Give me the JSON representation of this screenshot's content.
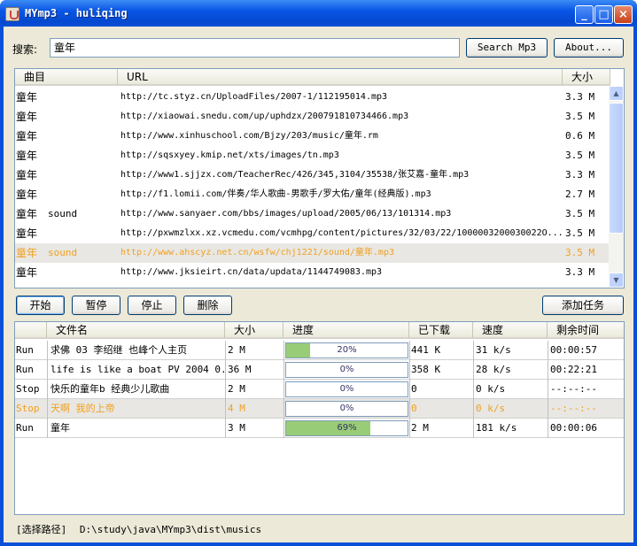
{
  "window": {
    "title": "MYmp3 - huliqing"
  },
  "search": {
    "label": "搜索:",
    "value": "童年",
    "search_button": "Search Mp3",
    "about_button": "About..."
  },
  "results": {
    "headers": {
      "song": "曲目",
      "url": "URL",
      "size": "大小"
    },
    "rows": [
      {
        "title": "童年",
        "artist": "",
        "url": "http://tc.styz.cn/UploadFiles/2007-1/112195014.mp3",
        "size": "3.3 M"
      },
      {
        "title": "童年",
        "artist": "",
        "url": "http://xiaowai.snedu.com/up/uphdzx/200791810734466.mp3",
        "size": "3.5 M"
      },
      {
        "title": "童年",
        "artist": "",
        "url": "http://www.xinhuschool.com/Bjzy/203/music/童年.rm",
        "size": "0.6 M"
      },
      {
        "title": "童年",
        "artist": "",
        "url": "http://sqsxyey.kmip.net/xts/images/tn.mp3",
        "size": "3.5 M"
      },
      {
        "title": "童年",
        "artist": "",
        "url": "http://www1.sjjzx.com/TeacherRec/426/345,3104/35538/张艾嘉-童年.mp3",
        "size": "3.3 M"
      },
      {
        "title": "童年",
        "artist": "",
        "url": "http://f1.lomii.com/伴奏/华人歌曲-男歌手/罗大佑/童年(经典版).mp3",
        "size": "2.7 M"
      },
      {
        "title": "童年",
        "artist": "sound",
        "url": "http://www.sanyaer.com/bbs/images/upload/2005/06/13/101314.mp3",
        "size": "3.5 M"
      },
      {
        "title": "童年",
        "artist": "",
        "url": "http://pxwmzlxx.xz.vcmedu.com/vcmhpg/content/pictures/32/03/22/1000003200030022O...",
        "size": "3.5 M"
      },
      {
        "title": "童年",
        "artist": "sound",
        "url": "http://www.ahscyz.net.cn/wsfw/chj1221/sound/童年.mp3",
        "size": "3.5 M"
      },
      {
        "title": "童年",
        "artist": "",
        "url": "http://www.jksieirt.cn/data/updata/1144749083.mp3",
        "size": "3.3 M"
      }
    ]
  },
  "controls": {
    "start": "开始",
    "pause": "暂停",
    "stop": "停止",
    "delete": "删除",
    "add_task": "添加任务"
  },
  "tasks": {
    "headers": {
      "file": "文件名",
      "size": "大小",
      "progress": "进度",
      "downloaded": "已下载",
      "speed": "速度",
      "remaining": "剩余时间"
    },
    "rows": [
      {
        "state": "Run",
        "file": "求佛 03 李绍继 也峰个人主页",
        "size": "2 M",
        "progress": 0.2,
        "progress_label": "20%",
        "downloaded": "441 K",
        "speed": "31 k/s",
        "remaining": "00:00:57"
      },
      {
        "state": "Run",
        "file": "life is like a boat PV 2004 0...",
        "size": "36 M",
        "progress": 0.0,
        "progress_label": "0%",
        "downloaded": "358 K",
        "speed": "28 k/s",
        "remaining": "00:22:21"
      },
      {
        "state": "Stop",
        "file": "快乐的童年b 经典少儿歌曲",
        "size": "2 M",
        "progress": 0.0,
        "progress_label": "0%",
        "downloaded": "0",
        "speed": "0 k/s",
        "remaining": "--:--:--"
      },
      {
        "state": "Stop",
        "file": "天啊 我的上帝",
        "size": "4 M",
        "progress": 0.0,
        "progress_label": "0%",
        "downloaded": "0",
        "speed": "0 k/s",
        "remaining": "--:--:--"
      },
      {
        "state": "Run",
        "file": "童年",
        "size": "3 M",
        "progress": 0.69,
        "progress_label": "69%",
        "downloaded": "2 M",
        "speed": "181 k/s",
        "remaining": "00:00:06"
      }
    ]
  },
  "statusbar": {
    "label": "[选择路径]",
    "path": "D:\\study\\java\\MYmp3\\dist\\musics"
  },
  "colors": {
    "selected_text": "#f0a020",
    "titlebar": "#0a56e6",
    "progress_fill": "#99cc77"
  }
}
